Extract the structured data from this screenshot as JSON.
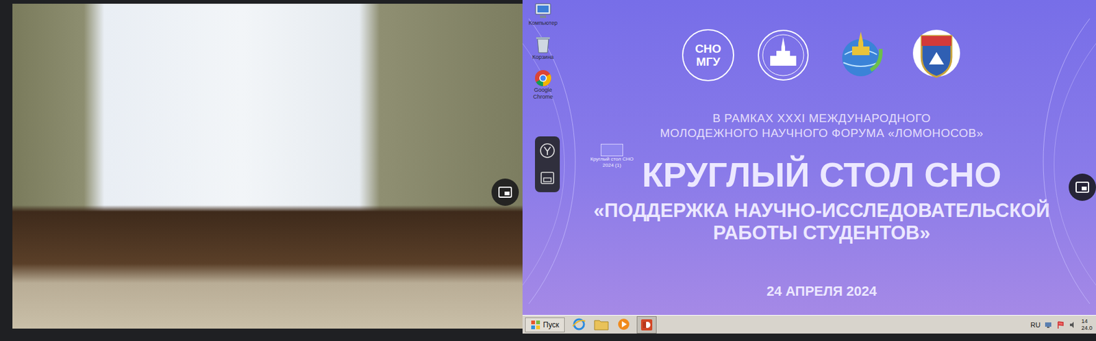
{
  "screen_share": {
    "desktop_icons": [
      {
        "label": "Компьютер"
      },
      {
        "label": "Корзина"
      },
      {
        "label": "Google Chrome"
      }
    ],
    "file_icon": {
      "label": "Круглый стол СНО 2024 (1)"
    },
    "slide": {
      "logo_lines": [
        "СНО",
        "МГУ"
      ],
      "context_lines": [
        "В РАМКАХ XXXI МЕЖДУНАРОДНОГО",
        "МОЛОДЕЖНОГО НАУЧНОГО ФОРУМА «ЛОМОНОСОВ»"
      ],
      "title": "КРУГЛЫЙ СТОЛ СНО",
      "subtitle_lines": [
        "«ПОДДЕРЖКА НАУЧНО-ИССЛЕДОВАТЕЛЬСКОЙ",
        "РАБОТЫ СТУДЕНТОВ»"
      ],
      "date": "24 АПРЕЛЯ 2024"
    },
    "taskbar": {
      "start": "Пуск",
      "language": "RU",
      "time": "14",
      "date": "24.0"
    }
  }
}
